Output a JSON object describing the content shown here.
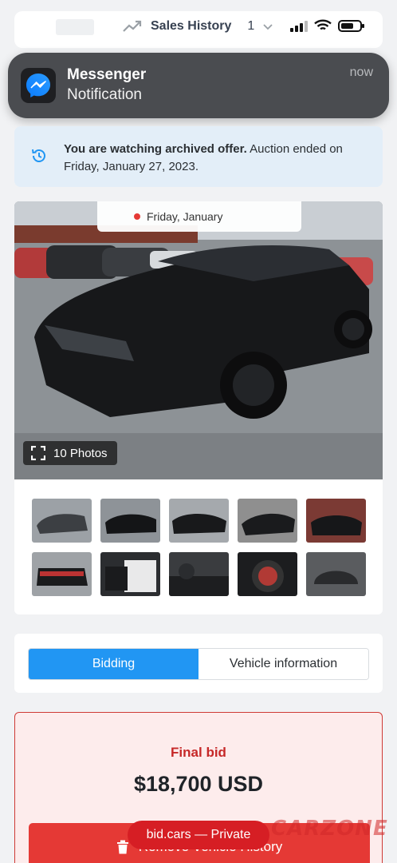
{
  "topbar": {
    "sales_history_label": "Sales History",
    "count": "1"
  },
  "notification": {
    "app": "Messenger",
    "body": "Notification",
    "time": "now"
  },
  "alert": {
    "bold_text": "You are watching archived offer.",
    "text": " Auction ended on Friday, January 27, 2023."
  },
  "gallery": {
    "date_label": "Friday, January",
    "photos_label": "10 Photos",
    "thumbnail_count": 10
  },
  "tabs": [
    {
      "label": "Bidding",
      "active": true
    },
    {
      "label": "Vehicle information",
      "active": false
    }
  ],
  "bid": {
    "label": "Final bid",
    "value": "$18,700 USD",
    "button_label": "Remove Vehicle History"
  },
  "overlay": {
    "url_label": "bid.cars — Private",
    "watermark": "CARZONE"
  },
  "colors": {
    "primary": "#2196f3",
    "danger": "#e53935",
    "alert_bg": "#e3eef8",
    "bid_bg": "#fdecec"
  }
}
